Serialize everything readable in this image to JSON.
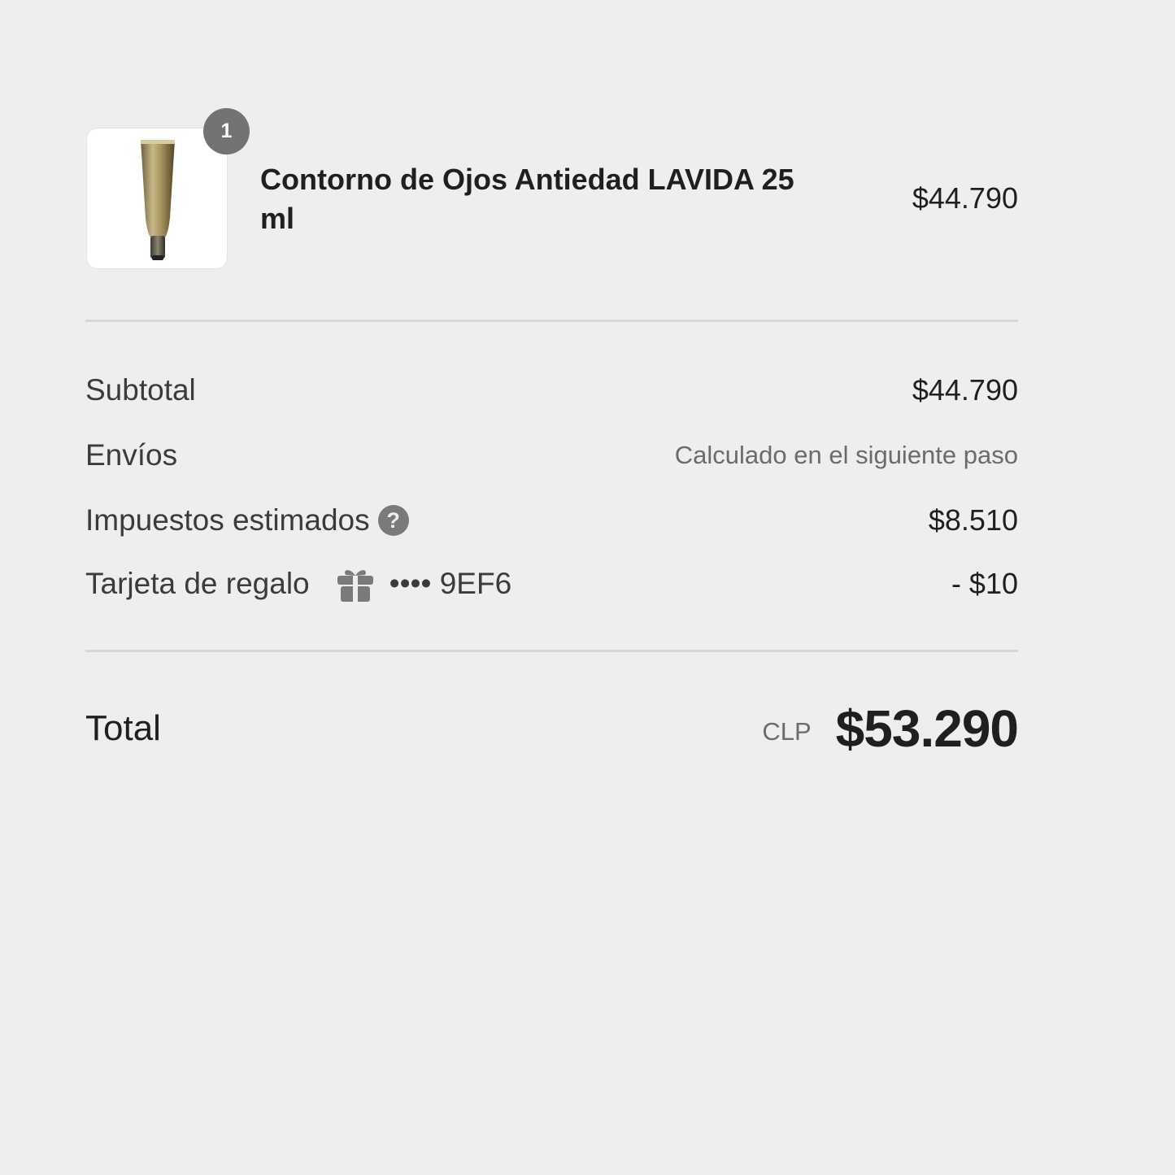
{
  "product": {
    "quantity": "1",
    "name": "Contorno de Ojos Antiedad LAVIDA 25 ml",
    "price": "$44.790",
    "image_icon": "tube-product-icon"
  },
  "summary": {
    "subtotal_label": "Subtotal",
    "subtotal_value": "$44.790",
    "shipping_label": "Envíos",
    "shipping_value": "Calculado en el siguiente paso",
    "taxes_label": "Impuestos estimados",
    "taxes_help_icon": "question-circle-icon",
    "taxes_value": "$8.510",
    "gift_card_label": "Tarjeta de regalo",
    "gift_card_icon": "gift-icon",
    "gift_card_code": "•••• 9EF6",
    "gift_card_value": "- $10"
  },
  "total": {
    "label": "Total",
    "currency": "CLP",
    "amount": "$53.290"
  },
  "colors": {
    "background": "#eeeeee",
    "badge": "#737373",
    "divider": "#d6d6d6",
    "muted_text": "#6b6b6b"
  }
}
